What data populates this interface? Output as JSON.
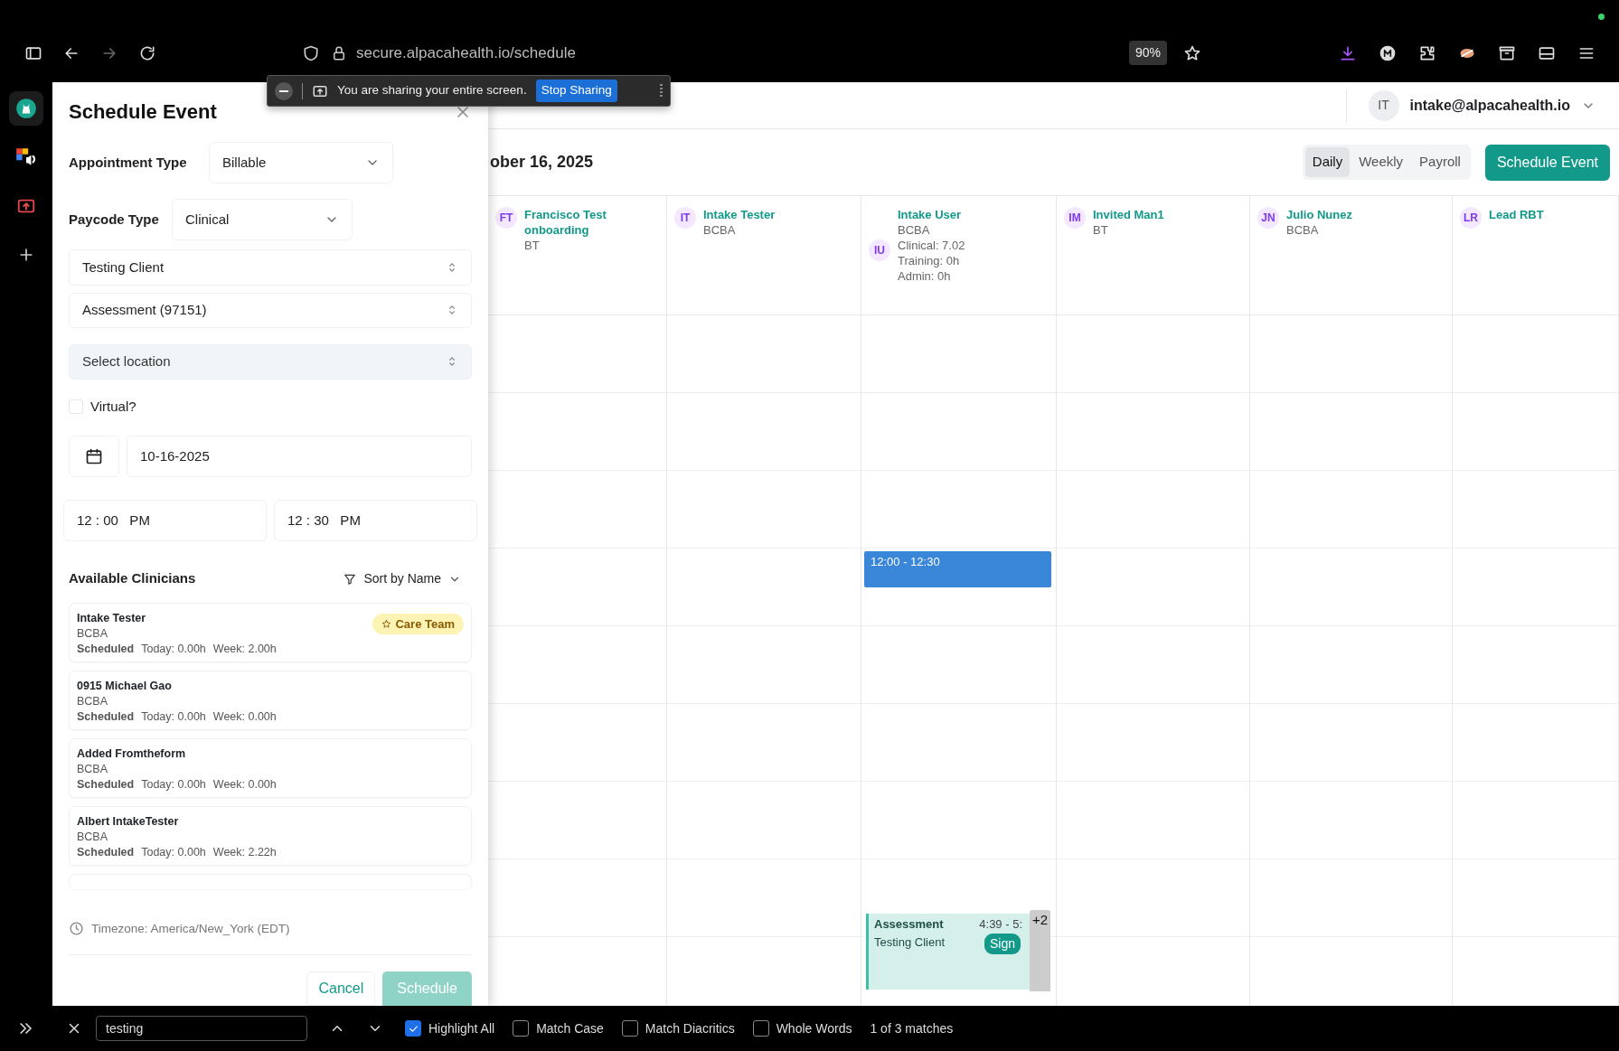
{
  "browser": {
    "url": "secure.alpacahealth.io/schedule",
    "zoom": "90%"
  },
  "sharing_bar": {
    "message": "You are sharing your entire screen.",
    "button": "Stop Sharing"
  },
  "modal": {
    "title": "Schedule Event",
    "appointment_type": {
      "label": "Appointment Type",
      "value": "Billable"
    },
    "paycode_type": {
      "label": "Paycode Type",
      "value": "Clinical"
    },
    "client": {
      "value": "Testing Client"
    },
    "service": {
      "value": "Assessment (97151)"
    },
    "location": {
      "placeholder": "Select location",
      "hovered": true
    },
    "virtual": {
      "label": "Virtual?",
      "checked": false
    },
    "date": "10-16-2025",
    "start_time": "12 : 00   PM",
    "end_time": "12 : 30   PM",
    "clinicians_title": "Available Clinicians",
    "sort": "Sort by Name",
    "clinicians": [
      {
        "name": "Intake Tester",
        "role": "BCBA",
        "status": "Scheduled",
        "today": "Today: 0.00h",
        "week": "Week: 2.00h",
        "badge": "Care Team"
      },
      {
        "name": "0915 Michael Gao",
        "role": "BCBA",
        "status": "Scheduled",
        "today": "Today: 0.00h",
        "week": "Week: 0.00h"
      },
      {
        "name": "Added Fromtheform",
        "role": "BCBA",
        "status": "Scheduled",
        "today": "Today: 0.00h",
        "week": "Week: 0.00h"
      },
      {
        "name": "Albert IntakeTester",
        "role": "BCBA",
        "status": "Scheduled",
        "today": "Today: 0.00h",
        "week": "Week: 2.22h"
      }
    ],
    "timezone": "Timezone: America/New_York (EDT)",
    "cancel": "Cancel",
    "submit": {
      "label": "Schedule",
      "disabled": true
    }
  },
  "app": {
    "user": {
      "initials": "IT",
      "email": "intake@alpacahealth.io"
    },
    "date_heading": "ober 16, 2025",
    "views": [
      {
        "label": "Daily",
        "selected": true
      },
      {
        "label": "Weekly",
        "selected": false
      },
      {
        "label": "Payroll",
        "selected": false
      }
    ],
    "schedule_button": "Schedule Event",
    "columns": [
      {
        "initials": "FT",
        "name": "Francisco Test onboarding",
        "lines": [
          "BT"
        ]
      },
      {
        "initials": "IT",
        "name": "Intake Tester",
        "lines": [
          "BCBA"
        ]
      },
      {
        "initials": "IU",
        "name": "Intake User",
        "lines": [
          "BCBA",
          "Clinical: 7.02",
          "Training: 0h",
          "Admin: 0h"
        ],
        "events": [
          {
            "kind": "draft",
            "time": "12:00 - 12:30"
          },
          {
            "kind": "appointment",
            "title": "Assessment",
            "time": "4:39 - 5:",
            "client": "Testing Client",
            "status": "Sign",
            "more": "+2"
          }
        ]
      },
      {
        "initials": "IM",
        "name": "Invited Man1",
        "lines": [
          "BT"
        ]
      },
      {
        "initials": "JN",
        "name": "Julio Nunez",
        "lines": [
          "BCBA"
        ]
      },
      {
        "initials": "LR",
        "name": "Lead RBT"
      }
    ]
  },
  "find_bar": {
    "query": "testing",
    "options": [
      {
        "label": "Highlight All",
        "checked": true
      },
      {
        "label": "Match Case",
        "checked": false
      },
      {
        "label": "Match Diacritics",
        "checked": false
      },
      {
        "label": "Whole Words",
        "checked": false
      }
    ],
    "result": "1 of 3 matches"
  }
}
